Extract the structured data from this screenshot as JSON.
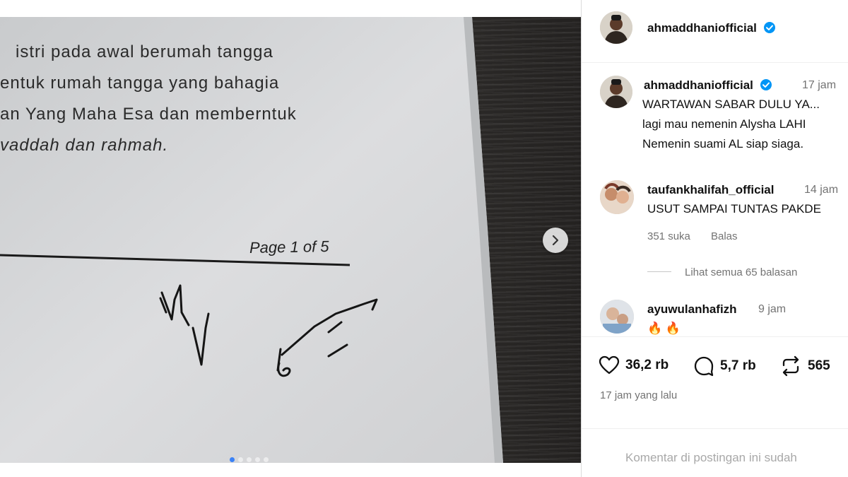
{
  "post": {
    "document": {
      "lines": [
        "istri pada awal berumah tangga",
        "entuk  rumah tangga yang bahagia",
        "an Yang Maha Esa dan memberntuk",
        "vaddah dan rahmah."
      ],
      "page_label": "Page 1 of 5"
    },
    "carousel": {
      "count": 5,
      "active": 0
    },
    "next_icon": "chevron-right-icon"
  },
  "header": {
    "username": "ahmaddhaniofficial",
    "verified_icon": "verified-badge-icon"
  },
  "caption": {
    "username": "ahmaddhaniofficial",
    "time": "17 jam",
    "lines": [
      "WARTAWAN SABAR DULU YA...",
      "lagi mau nemenin Alysha LAHI",
      "Nemenin suami AL siap siaga."
    ]
  },
  "comments": [
    {
      "username": "taufankhalifah_official",
      "time": "14 jam",
      "text": "USUT SAMPAI TUNTAS PAKDE",
      "likes": "351 suka",
      "reply": "Balas"
    },
    {
      "username": "ayuwulanhafizh",
      "time": "9 jam",
      "text": "🔥 🔥"
    }
  ],
  "view_replies": "Lihat semua 65 balasan",
  "actions": {
    "likes": "36,2 rb",
    "comments": "5,7 rb",
    "reposts": "565"
  },
  "timestamp": "17 jam yang lalu",
  "comment_notice": "Komentar di postingan ini sudah",
  "colors": {
    "verified": "#0095f6",
    "muted": "#737373",
    "dot_active": "#3b82f6"
  }
}
